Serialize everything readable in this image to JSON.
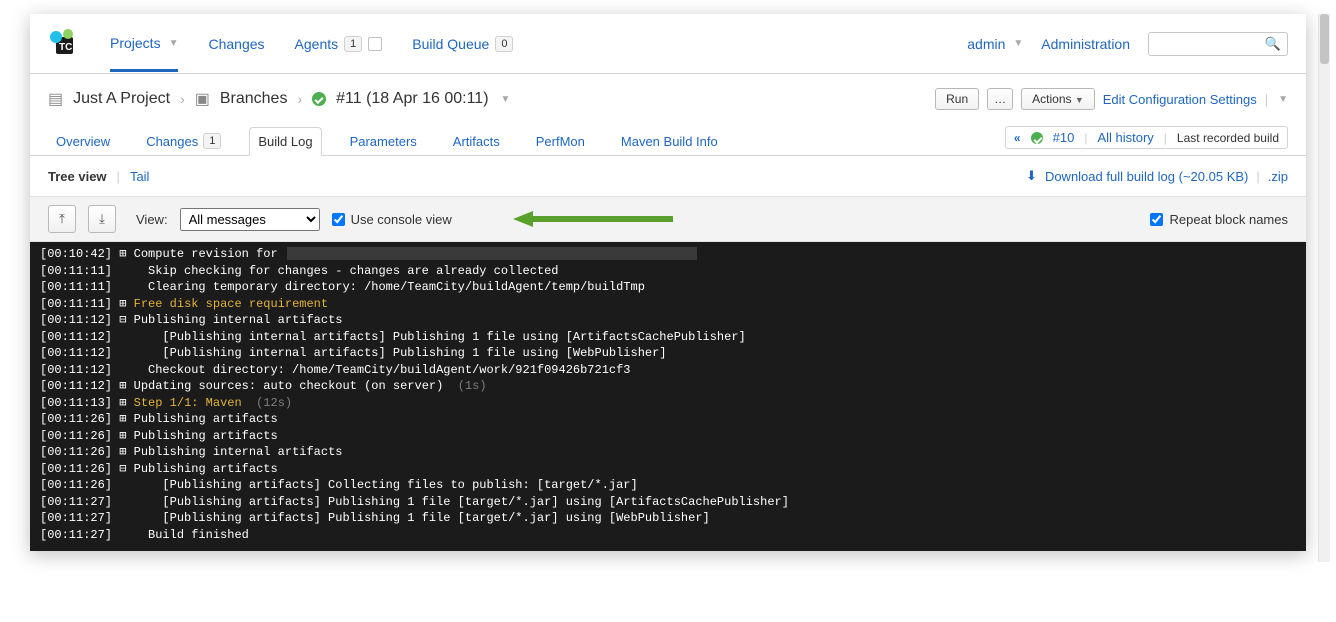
{
  "nav": {
    "projects": "Projects",
    "changes": "Changes",
    "agents": "Agents",
    "agents_count": "1",
    "queue": "Build Queue",
    "queue_count": "0",
    "admin_user": "admin",
    "administration": "Administration"
  },
  "breadcrumb": {
    "project": "Just A Project",
    "branches": "Branches",
    "build": "#11 (18 Apr 16 00:11)"
  },
  "actions": {
    "run": "Run",
    "more": "…",
    "actions": "Actions",
    "edit": "Edit Configuration Settings"
  },
  "tabs": {
    "overview": "Overview",
    "changes": "Changes",
    "changes_count": "1",
    "buildlog": "Build Log",
    "parameters": "Parameters",
    "artifacts": "Artifacts",
    "perfmon": "PerfMon",
    "maven": "Maven Build Info"
  },
  "prevnext": {
    "icon": "«",
    "build": "#10",
    "all": "All history",
    "last": "Last recorded build"
  },
  "subnav": {
    "tree": "Tree view",
    "tail": "Tail",
    "download": "Download full build log (~20.05 KB)",
    "zip": ".zip"
  },
  "controls": {
    "view_label": "View:",
    "select_value": "All messages",
    "console_label": "Use console view",
    "repeat_label": "Repeat block names"
  },
  "log": [
    {
      "ts": "[00:10:42]",
      "toggle": "+",
      "text": "Compute revision for ",
      "style": "default",
      "redacted": true
    },
    {
      "ts": "[00:11:11]",
      "toggle": " ",
      "text": "  Skip checking for changes - changes are already collected",
      "style": "default"
    },
    {
      "ts": "[00:11:11]",
      "toggle": " ",
      "text": "  Clearing temporary directory: /home/TeamCity/buildAgent/temp/buildTmp",
      "style": "default"
    },
    {
      "ts": "[00:11:11]",
      "toggle": "+",
      "text": "Free disk space requirement",
      "style": "warn"
    },
    {
      "ts": "[00:11:12]",
      "toggle": "-",
      "text": "Publishing internal artifacts",
      "style": "default"
    },
    {
      "ts": "[00:11:12]",
      "toggle": " ",
      "text": "    [Publishing internal artifacts] Publishing 1 file using [ArtifactsCachePublisher]",
      "style": "default"
    },
    {
      "ts": "[00:11:12]",
      "toggle": " ",
      "text": "    [Publishing internal artifacts] Publishing 1 file using [WebPublisher]",
      "style": "default"
    },
    {
      "ts": "[00:11:12]",
      "toggle": " ",
      "text": "  Checkout directory: /home/TeamCity/buildAgent/work/921f09426b721cf3",
      "style": "default"
    },
    {
      "ts": "[00:11:12]",
      "toggle": "+",
      "text": "Updating sources: auto checkout (on server)",
      "style": "default",
      "dur": "  (1s)"
    },
    {
      "ts": "[00:11:13]",
      "toggle": "+",
      "text": "Step 1/1: Maven",
      "style": "warn",
      "dur": "  (12s)"
    },
    {
      "ts": "[00:11:26]",
      "toggle": "+",
      "text": "Publishing artifacts",
      "style": "default"
    },
    {
      "ts": "[00:11:26]",
      "toggle": "+",
      "text": "Publishing artifacts",
      "style": "default"
    },
    {
      "ts": "[00:11:26]",
      "toggle": "+",
      "text": "Publishing internal artifacts",
      "style": "default"
    },
    {
      "ts": "[00:11:26]",
      "toggle": "-",
      "text": "Publishing artifacts",
      "style": "default"
    },
    {
      "ts": "[00:11:26]",
      "toggle": " ",
      "text": "    [Publishing artifacts] Collecting files to publish: [target/*.jar]",
      "style": "default"
    },
    {
      "ts": "[00:11:27]",
      "toggle": " ",
      "text": "    [Publishing artifacts] Publishing 1 file [target/*.jar] using [ArtifactsCachePublisher]",
      "style": "default"
    },
    {
      "ts": "[00:11:27]",
      "toggle": " ",
      "text": "    [Publishing artifacts] Publishing 1 file [target/*.jar] using [WebPublisher]",
      "style": "default"
    },
    {
      "ts": "[00:11:27]",
      "toggle": " ",
      "text": "  Build finished",
      "style": "default"
    }
  ]
}
